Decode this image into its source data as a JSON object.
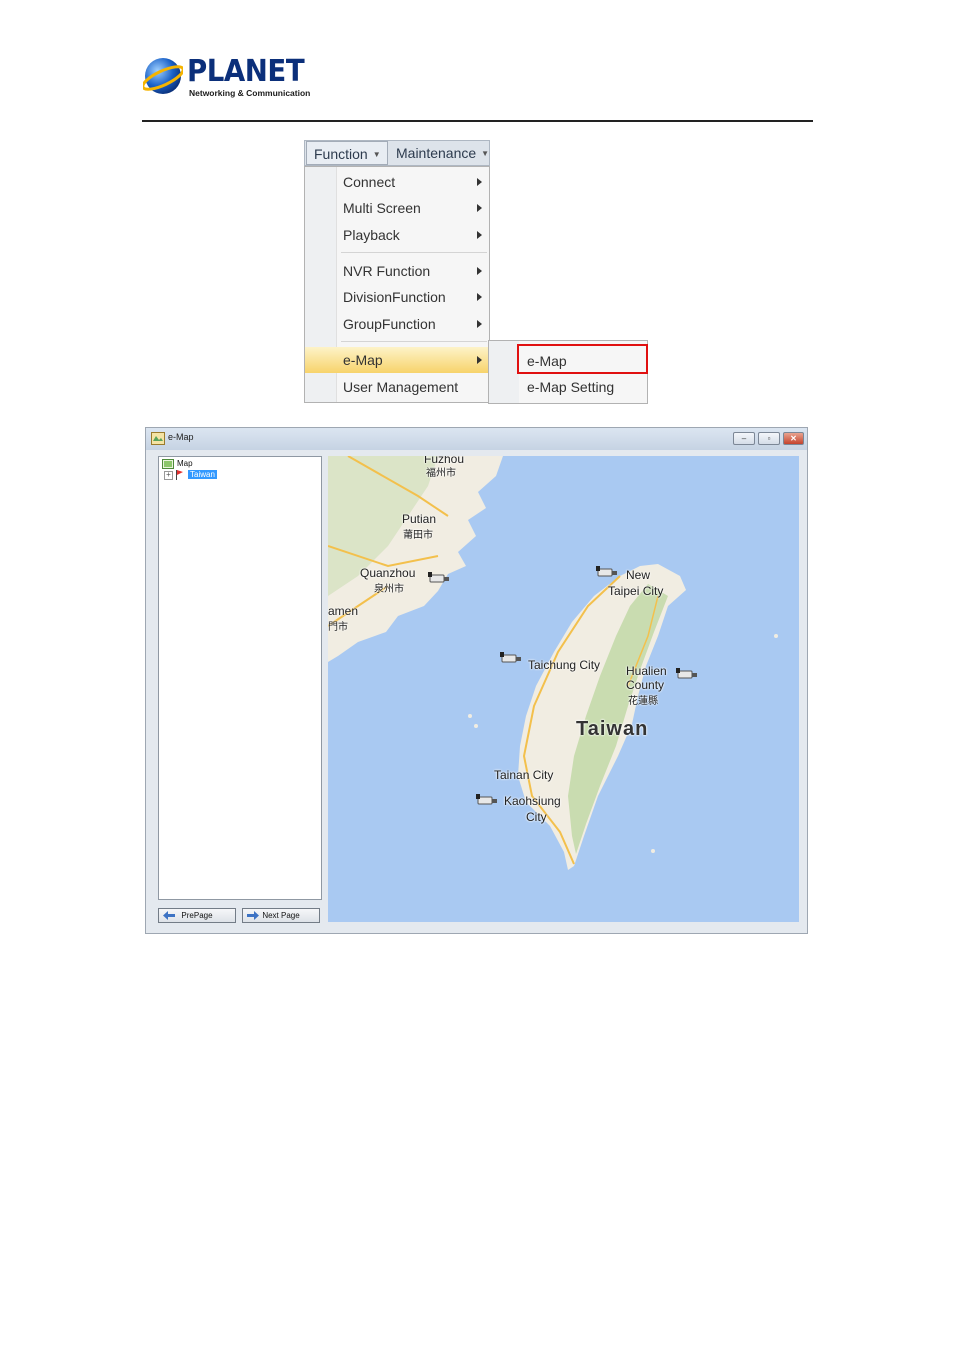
{
  "header": {
    "brand": "PLANET",
    "tagline": "Networking & Communication"
  },
  "menubar": {
    "function_label": "Function",
    "maintenance_label": "Maintenance"
  },
  "function_menu": {
    "items": [
      "Connect",
      "Multi Screen",
      "Playback",
      "NVR Function",
      "DivisionFunction",
      "GroupFunction",
      "e-Map",
      "User Management"
    ],
    "highlighted": "e-Map"
  },
  "emap_submenu": {
    "items": [
      "e-Map",
      "e-Map Setting"
    ],
    "boxed_item": "e-Map",
    "box_color": "#e01010"
  },
  "emap_window": {
    "title": "e-Map",
    "tree_root": "Map",
    "tree_child": "Taiwan",
    "prev_button": "PrePage",
    "next_button": "Next Page",
    "map": {
      "labels": {
        "fuzhou": "Fuzhou",
        "fuzhou_cn": "福州市",
        "putian": "Putian",
        "putian_cn": "莆田市",
        "quanzhou": "Quanzhou",
        "quanzhou_cn": "泉州市",
        "xiamen": "amen",
        "xiamen_cn": "門市",
        "new_taipei_1": "New",
        "new_taipei_2": "Taipei City",
        "taichung": "Taichung City",
        "hualien_1": "Hualien",
        "hualien_2": "County",
        "hualien_cn": "花蓮縣",
        "taiwan": "Taiwan",
        "tainan": "Tainan City",
        "kaohsiung_1": "Kaohsiung",
        "kaohsiung_2": "City"
      },
      "colors": {
        "sea": "#a9c9f2",
        "land": "#f1ede2",
        "terrain": "#c9dcb0",
        "road": "#f3c04c"
      }
    }
  }
}
